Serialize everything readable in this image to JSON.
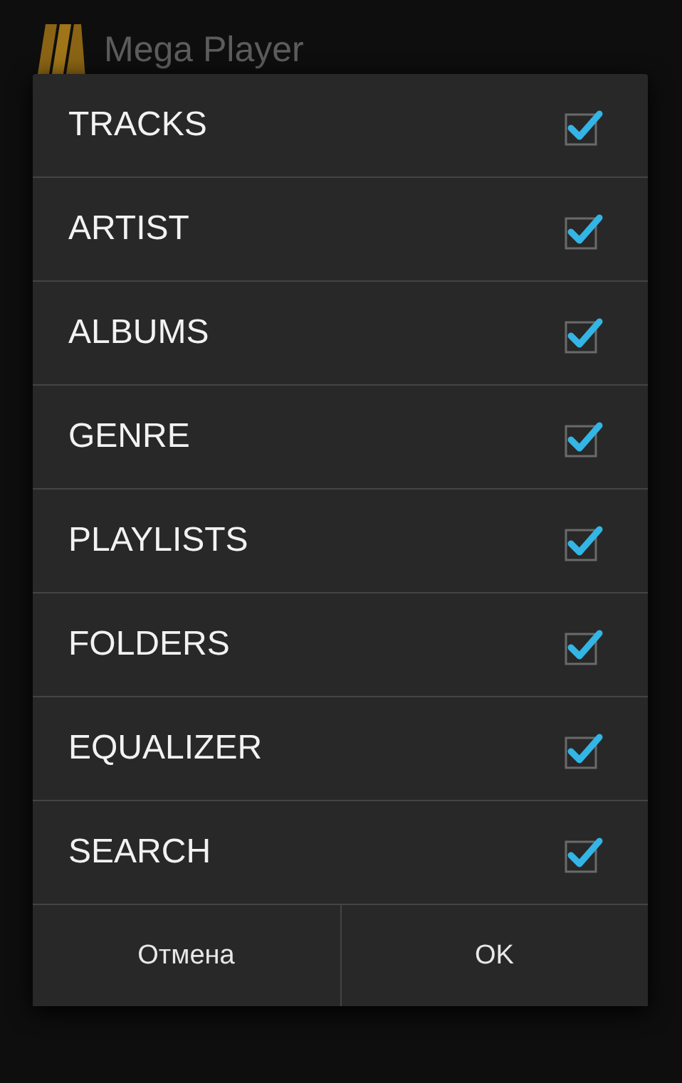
{
  "app_bar": {
    "title": "Mega Player"
  },
  "dialog": {
    "items": [
      {
        "label": "TRACKS",
        "checked": true
      },
      {
        "label": "ARTIST",
        "checked": true
      },
      {
        "label": "ALBUMS",
        "checked": true
      },
      {
        "label": "GENRE",
        "checked": true
      },
      {
        "label": "PLAYLISTS",
        "checked": true
      },
      {
        "label": "FOLDERS",
        "checked": true
      },
      {
        "label": "EQUALIZER",
        "checked": true
      },
      {
        "label": "SEARCH",
        "checked": true
      }
    ],
    "buttons": [
      "Отмена",
      "OK"
    ]
  }
}
